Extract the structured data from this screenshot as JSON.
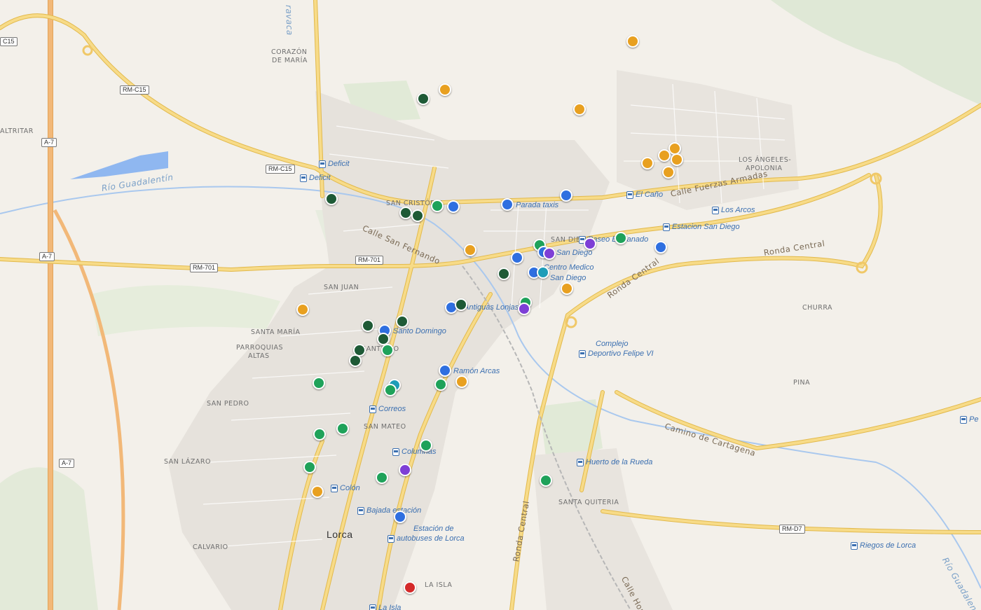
{
  "colors": {
    "orange": "#e8a020",
    "blue": "#2f6fe0",
    "green": "#1fa25a",
    "darkgreen": "#1e5a36",
    "purple": "#7e3fd6",
    "teal": "#1e9db8",
    "red": "#d42a2a",
    "road": "#f5d57c",
    "road_outline": "#e2b94c",
    "water": "#8fb7f0"
  },
  "city_label": "Lorca",
  "area_labels": [
    "CORAZÓN",
    "DE MARÍA",
    "ALTRITAR",
    "SAN CRISTÓBAL",
    "SAN JUAN",
    "SANTA MARÍA",
    "PARROQUIAS",
    "ALTAS",
    "SAN PEDRO",
    "SAN MATEO",
    "SAN LÁZARO",
    "CALVARIO",
    "LOS ÁNGELES-",
    "APOLONIA",
    "CHURRA",
    "PINA",
    "SANTA QUITERIA",
    "LA ISLA",
    "SAN DIEGO",
    "SANTIAGO"
  ],
  "street_labels": [
    "Calle San Fernando",
    "Calle Fuerzas Armadas",
    "Ronda Central",
    "Ronda Central",
    "Ronda Central",
    "Camino de Cartagena",
    "Calle Homo",
    "Río Guadalentín",
    "Río Guadalentín",
    "ravaca"
  ],
  "road_shields": [
    "C15",
    "RM-C15",
    "RM-C15",
    "A-7",
    "A-7",
    "A-7",
    "RM-701",
    "RM-701",
    "RM-D7"
  ],
  "poi_labels": [
    "Deficit",
    "Deficit",
    "Parada taxis",
    "El Caño",
    "Los Arcos",
    "Estacion San Diego",
    "Paseo Esplanado",
    "San Diego",
    "Centro Medico",
    "San Diego",
    "Antiguas Lonjas",
    "Santo Domingo",
    "Ramón Arcas",
    "Correos",
    "Columnas",
    "Colón",
    "Bajada estación",
    "Estación de",
    "autobuses de Lorca",
    "Complejo",
    "Deportivo Felipe VI",
    "Huerto de la Rueda",
    "Riegos de Lorca",
    "Pe",
    "La Isla"
  ],
  "markers": [
    {
      "color": "orange"
    },
    {
      "color": "darkgreen"
    },
    {
      "color": "orange"
    },
    {
      "color": "orange"
    },
    {
      "color": "orange"
    },
    {
      "color": "orange"
    },
    {
      "color": "orange"
    },
    {
      "color": "orange"
    },
    {
      "color": "orange"
    },
    {
      "color": "darkgreen"
    },
    {
      "color": "blue"
    },
    {
      "color": "darkgreen"
    },
    {
      "color": "darkgreen"
    },
    {
      "color": "green"
    },
    {
      "color": "blue"
    },
    {
      "color": "blue"
    },
    {
      "color": "orange"
    },
    {
      "color": "green"
    },
    {
      "color": "blue"
    },
    {
      "color": "purple"
    },
    {
      "color": "purple"
    },
    {
      "color": "green"
    },
    {
      "color": "blue"
    },
    {
      "color": "blue"
    },
    {
      "color": "darkgreen"
    },
    {
      "color": "blue"
    },
    {
      "color": "teal"
    },
    {
      "color": "orange"
    },
    {
      "color": "orange"
    },
    {
      "color": "blue"
    },
    {
      "color": "darkgreen"
    },
    {
      "color": "green"
    },
    {
      "color": "purple"
    },
    {
      "color": "darkgreen"
    },
    {
      "color": "blue"
    },
    {
      "color": "darkgreen"
    },
    {
      "color": "darkgreen"
    },
    {
      "color": "green"
    },
    {
      "color": "darkgreen"
    },
    {
      "color": "darkgreen"
    },
    {
      "color": "blue"
    },
    {
      "color": "green"
    },
    {
      "color": "green"
    },
    {
      "color": "teal"
    },
    {
      "color": "orange"
    },
    {
      "color": "green"
    },
    {
      "color": "green"
    },
    {
      "color": "green"
    },
    {
      "color": "green"
    },
    {
      "color": "green"
    },
    {
      "color": "purple"
    },
    {
      "color": "green"
    },
    {
      "color": "orange"
    },
    {
      "color": "blue"
    },
    {
      "color": "green"
    },
    {
      "color": "red"
    }
  ]
}
